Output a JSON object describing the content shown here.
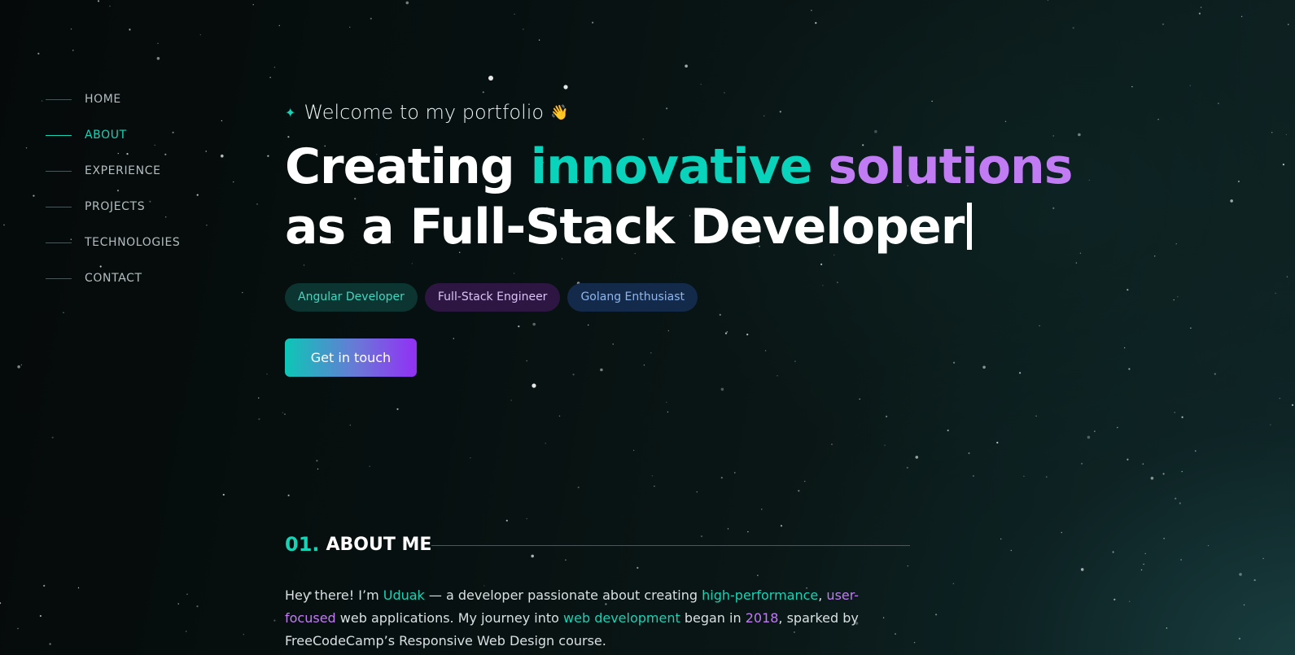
{
  "nav": {
    "items": [
      {
        "label": "HOME",
        "active": false
      },
      {
        "label": "ABOUT",
        "active": true
      },
      {
        "label": "EXPERIENCE",
        "active": false
      },
      {
        "label": "PROJECTS",
        "active": false
      },
      {
        "label": "TECHNOLOGIES",
        "active": false
      },
      {
        "label": "CONTACT",
        "active": false
      }
    ]
  },
  "hero": {
    "welcome_icon": "sparkle-icon",
    "welcome": "Welcome to my portfolio",
    "welcome_emoji": "👋",
    "headline_prefix": "Creating ",
    "headline_highlight_1": "innovative",
    "headline_highlight_2": "solutions",
    "headline_line2": "as a Full-Stack Developer",
    "tags": [
      "Angular Developer",
      "Full-Stack Engineer",
      "Golang Enthusiast"
    ],
    "cta_label": "Get in touch"
  },
  "about": {
    "number": "01.",
    "title": "ABOUT ME",
    "p1": "Hey there! I’m ",
    "name": "Uduak",
    "p2": " — a developer passionate about creating ",
    "h1": "high-performance",
    "p3": ", ",
    "h2": "user-focused",
    "p4": " web applications. My journey into ",
    "h3": "web development",
    "p5": " began in ",
    "year": "2018",
    "p6": ", sparked by FreeCodeCamp’s Responsive Web Design course."
  },
  "colors": {
    "accent_teal": "#17d3b6",
    "accent_purple": "#c17cf4",
    "background": "#071010"
  }
}
